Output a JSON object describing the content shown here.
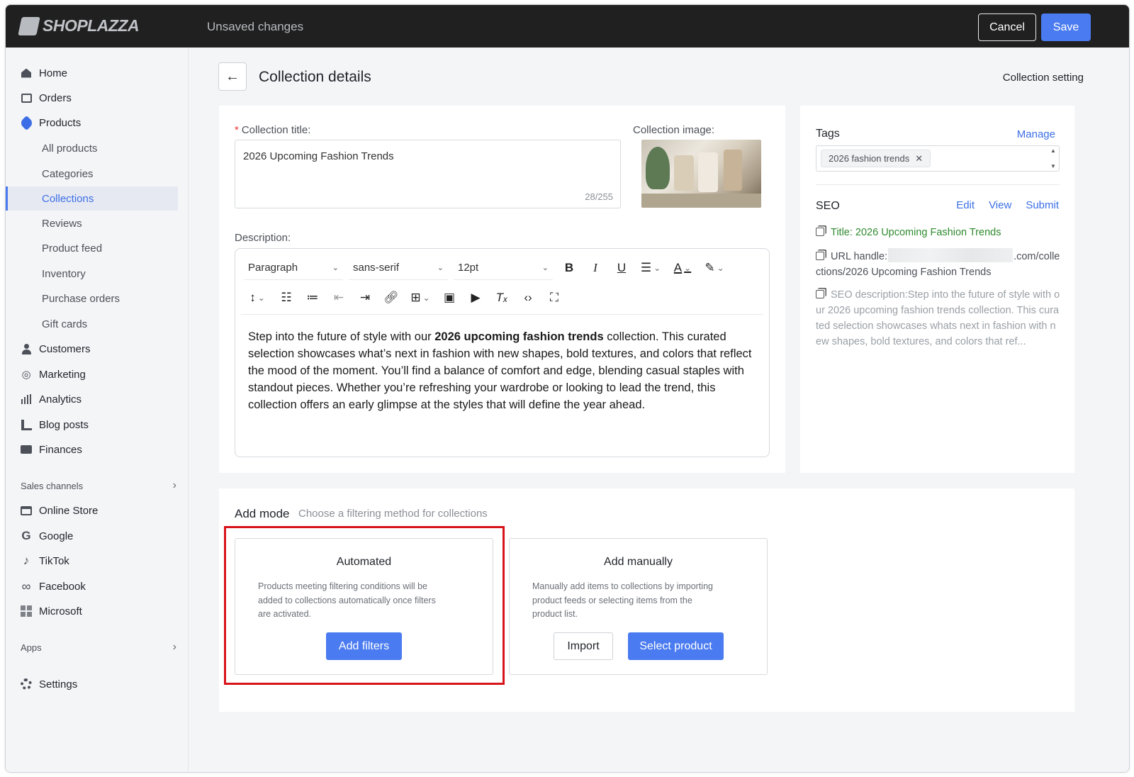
{
  "topbar": {
    "logo_text": "SHOPLAZZA",
    "status": "Unsaved changes",
    "cancel_label": "Cancel",
    "save_label": "Save",
    "save_color": "#4a7bf0"
  },
  "sidebar": {
    "items": [
      {
        "label": "Home",
        "icon": "home-icon"
      },
      {
        "label": "Orders",
        "icon": "inbox-icon"
      },
      {
        "label": "Products",
        "icon": "tag-icon"
      },
      {
        "label": "All products"
      },
      {
        "label": "Categories"
      },
      {
        "label": "Collections",
        "active": true
      },
      {
        "label": "Reviews"
      },
      {
        "label": "Product feed"
      },
      {
        "label": "Inventory"
      },
      {
        "label": "Purchase orders"
      },
      {
        "label": "Gift cards"
      },
      {
        "label": "Customers",
        "icon": "user-icon"
      },
      {
        "label": "Marketing",
        "icon": "target-icon"
      },
      {
        "label": "Analytics",
        "icon": "bar-chart-icon"
      },
      {
        "label": "Blog posts",
        "icon": "blog-icon"
      },
      {
        "label": "Finances",
        "icon": "wallet-icon"
      }
    ],
    "sales_channels_label": "Sales channels",
    "channels": [
      {
        "label": "Online Store",
        "icon": "store-icon"
      },
      {
        "label": "Google",
        "icon": "google-icon"
      },
      {
        "label": "TikTok",
        "icon": "tiktok-icon"
      },
      {
        "label": "Facebook",
        "icon": "meta-icon"
      },
      {
        "label": "Microsoft",
        "icon": "microsoft-icon"
      }
    ],
    "apps_label": "Apps",
    "settings_label": "Settings"
  },
  "header": {
    "title": "Collection details",
    "setting_link": "Collection setting"
  },
  "form": {
    "title_label": "Collection title:",
    "title_value": "2026 Upcoming Fashion Trends",
    "title_count": "28/255",
    "image_label": "Collection image:",
    "description_label": "Description:",
    "toolbar": {
      "paragraph": "Paragraph",
      "font": "sans-serif",
      "size": "12pt"
    },
    "description_before": "Step into the future of style with our ",
    "description_bold": "2026 upcoming fashion trends",
    "description_after": " collection. This curated selection showcases what’s next in fashion with new shapes, bold textures, and colors that reflect the mood of the moment. You’ll find a balance of comfort and edge, blending casual staples with standout pieces. Whether you’re refreshing your wardrobe or looking to lead the trend, this collection offers an early glimpse at the styles that will define the year ahead."
  },
  "side": {
    "tags_title": "Tags",
    "manage_label": "Manage",
    "tag_chip": "2026 fashion trends",
    "seo_title": "SEO",
    "seo_edit": "Edit",
    "seo_view": "View",
    "seo_submit": "Submit",
    "seo_title_line": "Title: 2026 Upcoming Fashion Trends",
    "seo_url_prefix": "URL handle:",
    "seo_url_suffix": ".com/collections/2026 Upcoming Fashion Trends",
    "seo_description": "SEO description:Step into the future of style with our 2026 upcoming fashion trends collection. This curated selection showcases whats next in fashion with new shapes, bold textures, and colors that ref..."
  },
  "add_mode": {
    "title": "Add mode",
    "subtitle": "Choose a filtering method for collections",
    "automated": {
      "heading": "Automated",
      "description": "Products meeting filtering conditions will be added to collections automatically once filters are activated.",
      "button": "Add filters"
    },
    "manual": {
      "heading": "Add manually",
      "description": "Manually add items to collections by importing product feeds or selecting items from the product list.",
      "import_button": "Import",
      "select_button": "Select product"
    },
    "highlight_color": "#d8141b"
  }
}
